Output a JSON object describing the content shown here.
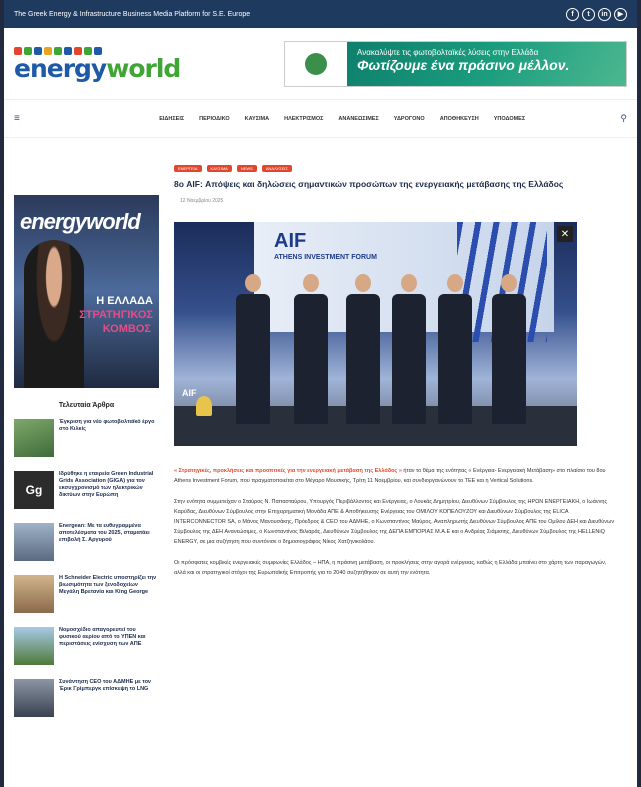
{
  "topbar": {
    "tagline": "The Greek Energy & Infrastructure Business Media Platform for S.E. Europe",
    "social": [
      {
        "icon": "facebook-icon",
        "glyph": "f"
      },
      {
        "icon": "twitter-icon",
        "glyph": "t"
      },
      {
        "icon": "linkedin-icon",
        "glyph": "in"
      },
      {
        "icon": "youtube-icon",
        "glyph": "▶"
      }
    ]
  },
  "logo": {
    "word_a": "energy",
    "word_b": "world"
  },
  "banner": {
    "line1": "Ανακαλύψτε τις φωτοβολταϊκές λύσεις στην Ελλάδα",
    "line2": "Φωτίζουμε ένα πράσινο μέλλον."
  },
  "nav": {
    "items": [
      "ΕΙΔΗΣΕΙΣ",
      "ΠΕΡΙΟΔΙΚΟ",
      "ΚΑΥΣΙΜΑ",
      "ΗΛΕΚΤΡΙΣΜΟΣ",
      "ΑΝΑΝΕΩΣΙΜΕΣ",
      "ΥΔΡΟΓΟΝΟ",
      "ΑΠΟΘΗΚΕΥΣΗ",
      "ΥΠΟΔΟΜΕΣ"
    ]
  },
  "magazine": {
    "title": "energyworld",
    "line1": "Η ΕΛΛΑΔΑ",
    "line2": "ΣΤΡΑΤΗΓΙΚΟΣ",
    "line3": "ΚΟΜΒΟΣ"
  },
  "sidebar": {
    "heading": "Τελευταία Άρθρα",
    "items": [
      {
        "text": "Έγκριση για νέο φωτοβολταϊκό έργο στο Κιλκίς",
        "thumb": "#3f6b3a"
      },
      {
        "text": "Ιδρύθηκε η εταιρεία Green Industrial Grids Association (GIGA) για τον εκσυγχρονισμό των ηλεκτρικών δικτύων στην Ευρώπη",
        "thumb": "#2c2c2c"
      },
      {
        "text": "Energean: Με τα ευθυγραμμένα αποτελέσματα του 2025, σταματάει επιβολή Σ. Αργυρού",
        "thumb": "#5a6b80"
      },
      {
        "text": "Η Schneider Electric υποστηρίζει την βιωσιμότητα των ξενοδοχείων Μεγάλη Βρετανία και King George",
        "thumb": "#8a6a4a"
      },
      {
        "text": "Νομοσχέδιο απαγορευτεί του φυσικού αερίου από το ΥΠΕΝ και περιστάσεις ενίσχυση των ΑΠΕ",
        "thumb": "#4d7a3a"
      },
      {
        "text": "Συνάντηση CEO του ΑΔΜΗΕ με τον Έρικ Γρίμπεργκ επίσκεψη το LNG",
        "thumb": "#394250"
      }
    ]
  },
  "article": {
    "categories": [
      "ΕΝΕΡΓΕΙΑ",
      "ΚΑΥΣΙΜΑ",
      "NEWS",
      "ΑΝΑΛΥΣΕΙΣ"
    ],
    "title": "8ο AIF: Απόψεις και δηλώσεις σημαντικών προσώπων της ενεργειακής μετάβασης της Ελλάδος",
    "date": "12 Νοεμβρίου 2025",
    "photo": {
      "screen_title": "AIF",
      "screen_sub": "ATHENS INVESTMENT FORUM",
      "corner_logo": "AIF"
    },
    "p1_hl": "« Στρατηγικές, προκλήσεις και προοπτικές για την ενεργειακή μετάβαση της Ελλάδος »",
    "p1": " ήταν το θέμα της ενότητας « Ενέργεια- Ενεργειακή Μετάβαση» στο πλαίσιο του 8ου Athens Investment Forum, που πραγματοποιείται στο Μέγαρο Μουσικής, Τρίτη 11 Νοεμβρίου, και συνδιοργανώνουν το ΤΕΕ και η Vertical Solutions.",
    "p2": "Στην ενότητα συμμετείχαν ο Σταύρος Ν. Παπασταύρου, Υπουργός Περιβάλλοντος και Ενέργειας, ο Λουκάς Δημητρίου, Διευθύνων Σύμβουλος της ΗΡΩΝ ΕΝΕΡΓΕΙΑΚΗ, ο Ιωάννης Καρύδας, Διευθύνων Σύμβουλος στην Επιχειρηματική Μονάδα ΑΠΕ & Αποθήκευσης Ενέργειας του ΟΜΙΛΟΥ ΚΟΠΕΛΟΥΖΟΥ και Διευθύνων Σύμβουλος της ELICA INTERCONNECTOR SA, ο Μάνος Μανουσάκης, Πρόεδρος & CEO του ΑΔΜΗΕ, ο Κωνσταντίνος Μαύρος, Αναπληρωτής Διευθύνων Σύμβουλος ΑΠΕ του Ομίλου ΔΕΗ και Διευθύνων Σύμβουλος της ΔΕΗ Ανανεώσιμες, ο Κωνσταντίνος Βιλιαράς, Διευθύνων Σύμβουλος της ΔΕΠΑ ΕΜΠΟΡΙΑΣ Μ.Α.Ε και ο Ανδρέας Σιάμισιης, Διευθύνων Σύμβουλος της HELLENiQ ENERGY, σε μια συζήτηση που συντόνισε ο δημοσιογράφος Νίκος Χατζηνικολάου.",
    "p3": "Οι πρόσφατες κομβικές ενεργειακές συμφωνίες Ελλάδος – ΗΠΑ, η πράσινη μετάβαση, οι προκλήσεις στην αγορά ενέργειας, καθώς η Ελλάδα μπαίνει στο χάρτη των παραγωγών, αλλά και οι στρατηγικοί στόχοι της Ευρωπαϊκής Επιτροπής για το 2040 συζητήθηκαν σε αυτή την ενότητα."
  }
}
